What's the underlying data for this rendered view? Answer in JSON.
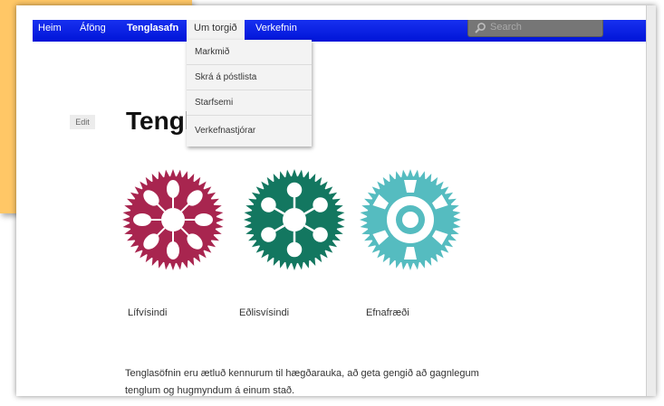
{
  "nav": {
    "items": [
      {
        "label": "Heim"
      },
      {
        "label": "Áföng"
      },
      {
        "label": "Tenglasafn"
      },
      {
        "label": "Um torgið"
      },
      {
        "label": "Verkefnin"
      }
    ],
    "search_placeholder": "Search"
  },
  "dropdown": {
    "items": [
      "Markmið",
      "Skrá á póstlista",
      "Starfsemi",
      "Verkefnastjórar"
    ]
  },
  "page": {
    "edit_label": "Edit",
    "title": "Tenglasafn",
    "intro": "Tenglasöfnin eru ætluð kennurum til hægðarauka, að geta gengið að gagnlegum tenglum og hugmyndum á einum stað."
  },
  "categories": [
    {
      "label": "Lífvísindi",
      "color": "#a8254f",
      "icon": "leaf-gear-icon"
    },
    {
      "label": "Eðlisvísindi",
      "color": "#137760",
      "icon": "atom-gear-icon"
    },
    {
      "label": "Efnafræði",
      "color": "#55bcc0",
      "icon": "flask-gear-icon"
    }
  ],
  "colors": {
    "navbar": "#0a20e6",
    "orange_panel": "#ffc766"
  }
}
